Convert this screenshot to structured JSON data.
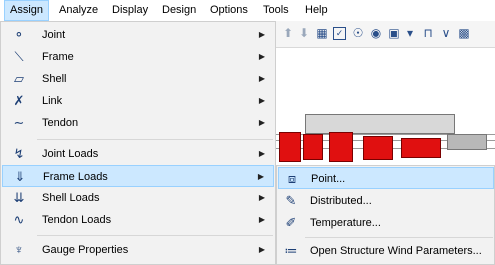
{
  "menubar": {
    "items": [
      "Assign",
      "Analyze",
      "Display",
      "Design",
      "Options",
      "Tools",
      "Help"
    ],
    "active_index": 0
  },
  "assign_menu": {
    "items": [
      {
        "label": "Joint",
        "icon": "joint-icon",
        "has_submenu": true
      },
      {
        "label": "Frame",
        "icon": "frame-icon",
        "has_submenu": true
      },
      {
        "label": "Shell",
        "icon": "shell-icon",
        "has_submenu": true
      },
      {
        "label": "Link",
        "icon": "link-icon",
        "has_submenu": true
      },
      {
        "label": "Tendon",
        "icon": "tendon-icon",
        "has_submenu": true
      },
      {
        "label": "Joint Loads",
        "icon": "joint-loads-icon",
        "has_submenu": true
      },
      {
        "label": "Frame Loads",
        "icon": "frame-loads-icon",
        "has_submenu": true,
        "highlighted": true
      },
      {
        "label": "Shell Loads",
        "icon": "shell-loads-icon",
        "has_submenu": true
      },
      {
        "label": "Tendon Loads",
        "icon": "tendon-loads-icon",
        "has_submenu": true
      },
      {
        "label": "Gauge Properties",
        "icon": "gauge-properties-icon",
        "has_submenu": true
      }
    ]
  },
  "frame_loads_submenu": {
    "items": [
      {
        "label": "Point...",
        "icon": "point-load-icon",
        "highlighted": true
      },
      {
        "label": "Distributed...",
        "icon": "distributed-load-icon"
      },
      {
        "label": "Temperature...",
        "icon": "temperature-load-icon"
      },
      {
        "label": "Open Structure Wind Parameters...",
        "icon": "wind-parameters-icon"
      }
    ]
  },
  "colors": {
    "highlight": "#cce8ff",
    "highlight_border": "#99d1ff",
    "menu_bg": "#f2f2f2",
    "model_red": "#e01010"
  }
}
